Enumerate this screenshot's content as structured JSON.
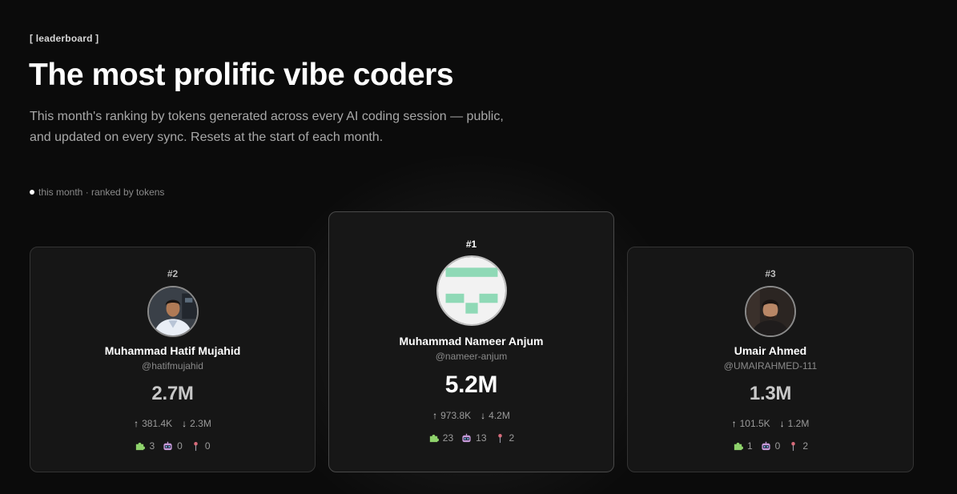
{
  "header": {
    "eyebrow": "[ leaderboard ]",
    "title": "The most prolific vibe coders",
    "subtitle": "This month's ranking by tokens generated across every AI coding session — public, and updated on every sync. Resets at the start of each month.",
    "meta": "this month · ranked by tokens"
  },
  "podium": [
    {
      "rank": "#2",
      "name": "Muhammad Hatif Mujahid",
      "handle": "@hatifmujahid",
      "tokens": "2.7M",
      "up": "381.4K",
      "down": "2.3M",
      "badge_puzzle": "3",
      "badge_robot": "0",
      "badge_pin": "0"
    },
    {
      "rank": "#1",
      "name": "Muhammad Nameer Anjum",
      "handle": "@nameer-anjum",
      "tokens": "5.2M",
      "up": "973.8K",
      "down": "4.2M",
      "badge_puzzle": "23",
      "badge_robot": "13",
      "badge_pin": "2"
    },
    {
      "rank": "#3",
      "name": "Umair Ahmed",
      "handle": "@UMAIRAHMED-111",
      "tokens": "1.3M",
      "up": "101.5K",
      "down": "1.2M",
      "badge_puzzle": "1",
      "badge_robot": "0",
      "badge_pin": "2"
    }
  ],
  "icons": {
    "up": "arrow-up-icon",
    "down": "arrow-down-icon",
    "puzzle": "puzzle-icon",
    "robot": "robot-icon",
    "pin": "pin-icon"
  },
  "colors": {
    "background": "#0b0b0b",
    "card": "#161616",
    "identicon": "#8fd9b6"
  }
}
